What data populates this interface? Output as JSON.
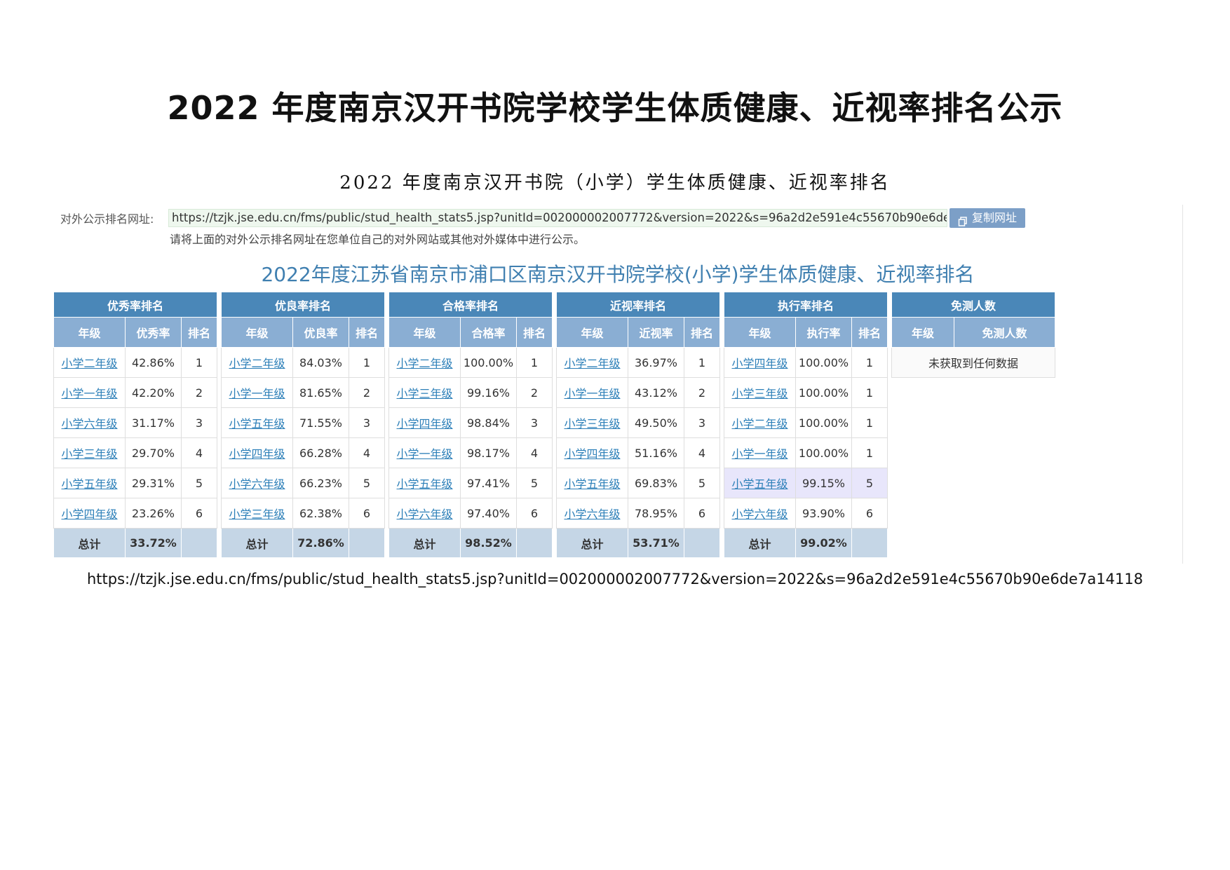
{
  "doc_title": "2022 年度南京汉开书院学校学生体质健康、近视率排名公示",
  "doc_subtitle": "2022 年度南京汉开书院（小学）学生体质健康、近视率排名",
  "url_label": "对外公示排名网址:",
  "url_value": "https://tzjk.jse.edu.cn/fms/public/stud_health_stats5.jsp?unitId=002000002007772&version=2022&s=96a2d2e591e4c55670b90e6de7a14118",
  "copy_button_label": "复制网址",
  "url_hint": "请将上面的对外公示排名网址在您单位自己的对外网站或其他对外媒体中进行公示。",
  "inner_title": "2022年度江苏省南京市浦口区南京汉开书院学校(小学)学生体质健康、近视率排名",
  "tables": [
    {
      "title": "优秀率排名",
      "headers": [
        "年级",
        "优秀率",
        "排名"
      ],
      "rows": [
        [
          "小学二年级",
          "42.86%",
          "1"
        ],
        [
          "小学一年级",
          "42.20%",
          "2"
        ],
        [
          "小学六年级",
          "31.17%",
          "3"
        ],
        [
          "小学三年级",
          "29.70%",
          "4"
        ],
        [
          "小学五年级",
          "29.31%",
          "5"
        ],
        [
          "小学四年级",
          "23.26%",
          "6"
        ]
      ],
      "total_label": "总计",
      "total_value": "33.72%"
    },
    {
      "title": "优良率排名",
      "headers": [
        "年级",
        "优良率",
        "排名"
      ],
      "rows": [
        [
          "小学二年级",
          "84.03%",
          "1"
        ],
        [
          "小学一年级",
          "81.65%",
          "2"
        ],
        [
          "小学五年级",
          "71.55%",
          "3"
        ],
        [
          "小学四年级",
          "66.28%",
          "4"
        ],
        [
          "小学六年级",
          "66.23%",
          "5"
        ],
        [
          "小学三年级",
          "62.38%",
          "6"
        ]
      ],
      "total_label": "总计",
      "total_value": "72.86%"
    },
    {
      "title": "合格率排名",
      "headers": [
        "年级",
        "合格率",
        "排名"
      ],
      "rows": [
        [
          "小学二年级",
          "100.00%",
          "1"
        ],
        [
          "小学三年级",
          "99.16%",
          "2"
        ],
        [
          "小学四年级",
          "98.84%",
          "3"
        ],
        [
          "小学一年级",
          "98.17%",
          "4"
        ],
        [
          "小学五年级",
          "97.41%",
          "5"
        ],
        [
          "小学六年级",
          "97.40%",
          "6"
        ]
      ],
      "total_label": "总计",
      "total_value": "98.52%"
    },
    {
      "title": "近视率排名",
      "headers": [
        "年级",
        "近视率",
        "排名"
      ],
      "rows": [
        [
          "小学二年级",
          "36.97%",
          "1"
        ],
        [
          "小学一年级",
          "43.12%",
          "2"
        ],
        [
          "小学三年级",
          "49.50%",
          "3"
        ],
        [
          "小学四年级",
          "51.16%",
          "4"
        ],
        [
          "小学五年级",
          "69.83%",
          "5"
        ],
        [
          "小学六年级",
          "78.95%",
          "6"
        ]
      ],
      "total_label": "总计",
      "total_value": "53.71%"
    },
    {
      "title": "执行率排名",
      "headers": [
        "年级",
        "执行率",
        "排名"
      ],
      "rows": [
        [
          "小学四年级",
          "100.00%",
          "1"
        ],
        [
          "小学三年级",
          "100.00%",
          "1"
        ],
        [
          "小学二年级",
          "100.00%",
          "1"
        ],
        [
          "小学一年级",
          "100.00%",
          "1"
        ],
        [
          "小学五年级",
          "99.15%",
          "5"
        ],
        [
          "小学六年级",
          "93.90%",
          "6"
        ]
      ],
      "highlight_row": 4,
      "total_label": "总计",
      "total_value": "99.02%"
    }
  ],
  "exempt_table": {
    "title": "免测人数",
    "headers": [
      "年级",
      "免测人数"
    ],
    "empty_text": "未获取到任何数据"
  },
  "footer_url": "https://tzjk.jse.edu.cn/fms/public/stud_health_stats5.jsp?unitId=002000002007772&version=2022&s=96a2d2e591e4c55670b90e6de7a14118"
}
